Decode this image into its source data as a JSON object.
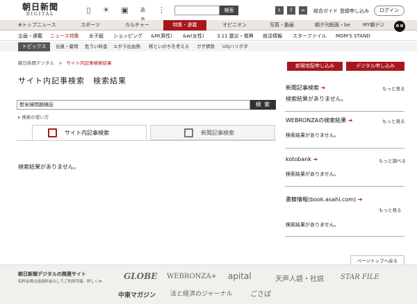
{
  "header": {
    "logo_main": "朝日新聞",
    "logo_sub": "DIGITAL",
    "icons": [
      "mobile-icon",
      "weather-icon",
      "tv-icon",
      "aa-icon",
      "grid-icon"
    ],
    "aa_text": "あぁ",
    "search_placeholder": "",
    "search_button": "検索",
    "social": [
      "twitter-icon",
      "facebook-icon",
      "rss-icon"
    ],
    "guide_link": "総合ガイド",
    "register_link": "登録申し込み",
    "login_button": "ログイン"
  },
  "gnav": [
    "⊕トップニュース",
    "スポーツ",
    "カルチャー",
    "特集・連載",
    "オピニオン",
    "写真・動画",
    "朝夕刊紙面・be",
    "MY朝デジ"
  ],
  "subnav": [
    "企画・連載",
    "ニュース特集",
    "女子組",
    "ショッピング",
    "&M(男性)",
    "&w(女性)",
    "3.11 震災・復興",
    "就活情報",
    "スターファイル",
    "MOM'S STAND"
  ],
  "topics": {
    "label": "トピックス",
    "items": [
      "台風・豪雨",
      "危うい料金",
      "エボラ出血熱",
      "核といのちを考える",
      "ガザ情勢",
      "USJハリポタ"
    ]
  },
  "breadcrumb": {
    "home": "朝日新聞デジタル",
    "sep": ">",
    "current": "サイト内記事検索結果"
  },
  "page_title": "サイト内記事検索　検索結果",
  "search": {
    "query": "慰安婦問題検証",
    "button": "検 索",
    "howto": "検索の使い方"
  },
  "tabs": {
    "site": "サイト内記事検索",
    "news": "新聞記事検索"
  },
  "main_result": "検索結果がありません。",
  "sidebar": {
    "btn_delivery": "新聞宅配申し込み",
    "btn_digital": "デジタル申し込み",
    "sections": [
      {
        "title": "新聞記事検索",
        "more": "もっと見る",
        "result": "検索結果がありません。"
      },
      {
        "title": "WEBRONZAの検索結果",
        "more": "もっと見る",
        "result": "検索結果がありません。"
      },
      {
        "title": "kotobank",
        "more": "もっと調べる",
        "result": "検索結果がありません。"
      },
      {
        "title": "書籍情報(book.asahi.com)",
        "more": "もっと見る",
        "result": "検索結果がありません。"
      }
    ]
  },
  "pagetop": "ページトップへ戻る",
  "footer": {
    "title": "朝日新聞デジタルの関連サイト",
    "note": "有料会員は追加料金なしでご利用可能。詳しく≫",
    "sites": [
      "GLOBE",
      "WEBRONZA+",
      "apital",
      "天声人語・社説",
      "STAR FILE",
      "中東マガジン",
      "法と経済のジャーナル",
      "ごさぱ"
    ]
  },
  "colors": {
    "accent": "#a8161b"
  }
}
